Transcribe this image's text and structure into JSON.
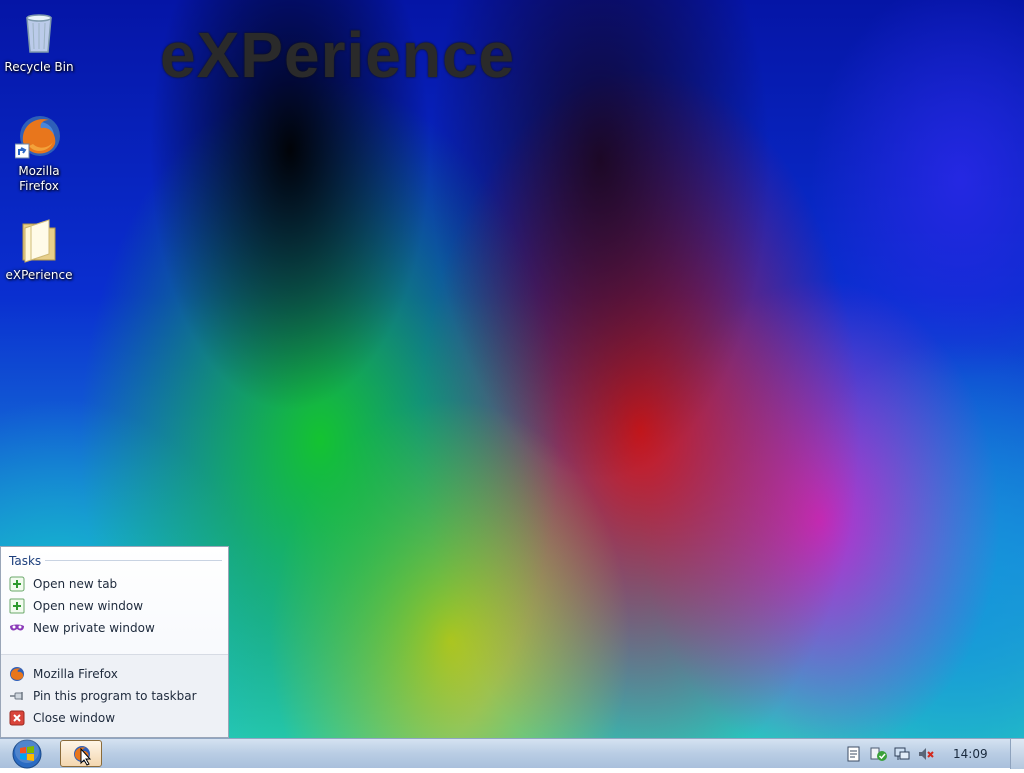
{
  "wallpaper": {
    "title": "eXPerience"
  },
  "desktop_icons": [
    {
      "label": "Recycle Bin",
      "icon": "recycle-bin-icon"
    },
    {
      "label": "Mozilla\nFirefox",
      "icon": "firefox-icon"
    },
    {
      "label": "eXPerience",
      "icon": "folder-icon"
    }
  ],
  "jumplist": {
    "header": "Tasks",
    "tasks": [
      {
        "label": "Open new tab",
        "icon": "plus-icon"
      },
      {
        "label": "Open new window",
        "icon": "plus-icon"
      },
      {
        "label": "New private window",
        "icon": "mask-icon"
      }
    ],
    "actions": [
      {
        "label": "Mozilla Firefox",
        "icon": "firefox-icon"
      },
      {
        "label": "Pin this program to taskbar",
        "icon": "pin-icon"
      },
      {
        "label": "Close window",
        "icon": "close-icon"
      }
    ]
  },
  "taskbar": {
    "clock": "14:09",
    "tray_icons": [
      "action-center-icon",
      "security-icon",
      "network-icon",
      "volume-muted-icon"
    ]
  },
  "colors": {
    "taskbar": "#b9cde4",
    "menu_header": "#1d3f7c",
    "accent_green": "#3aa13a"
  }
}
